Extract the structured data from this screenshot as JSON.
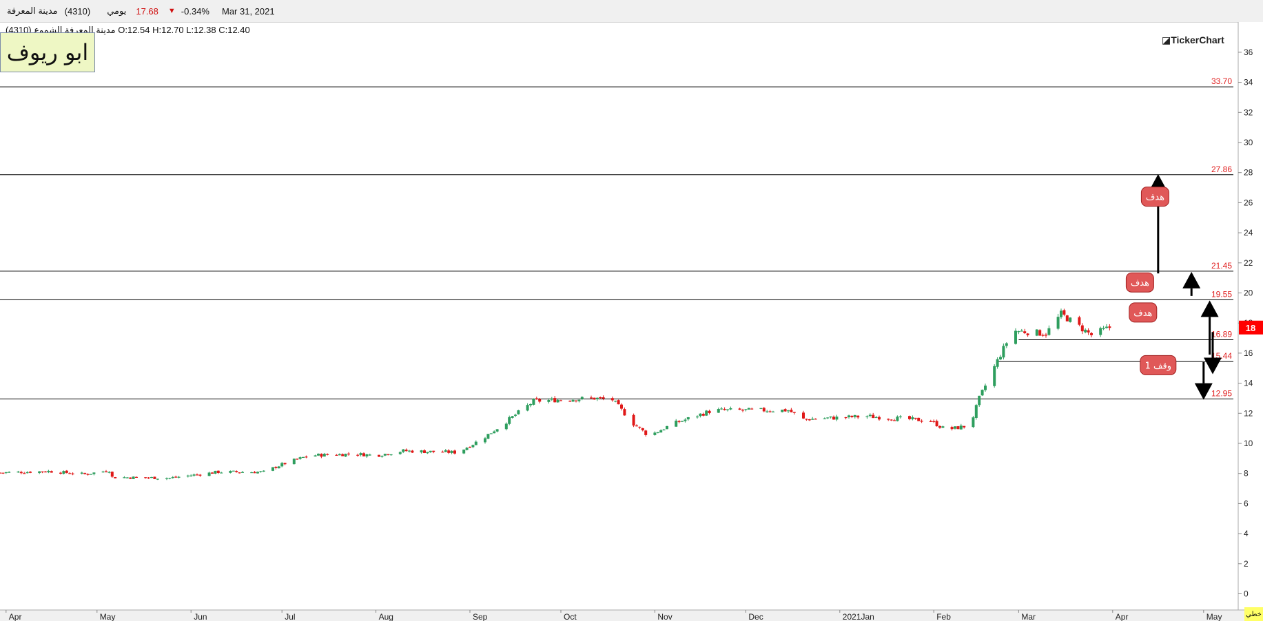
{
  "header": {
    "name": "مدينة المعرفة",
    "code": "(4310)",
    "period": "يومي",
    "price": "17.68",
    "change": "-0.34%",
    "date": "Mar 31, 2021",
    "down_color": "#d01010"
  },
  "ohlc_line": "مدينة المعرفة الشموع (4310) O:12.54  H:12.70  L:12.38  C:12.40",
  "watermark_text": "ابو ريوف",
  "logo_text": "◪TickerChart",
  "corner_label": "خطي",
  "chart_data": {
    "type": "candlestick",
    "y_range": [
      0,
      37
    ],
    "y_ticks": [
      0,
      2,
      4,
      6,
      8,
      10,
      12,
      14,
      16,
      18,
      20,
      22,
      24,
      26,
      28,
      30,
      32,
      34,
      36
    ],
    "x_domain": [
      "2020-03-30",
      "2021-05-04"
    ],
    "x_labels": [
      {
        "date": "2020-04-01",
        "label": "Apr"
      },
      {
        "date": "2020-05-01",
        "label": "May"
      },
      {
        "date": "2020-06-01",
        "label": "Jun"
      },
      {
        "date": "2020-07-01",
        "label": "Jul"
      },
      {
        "date": "2020-08-01",
        "label": "Aug"
      },
      {
        "date": "2020-09-01",
        "label": "Sep"
      },
      {
        "date": "2020-10-01",
        "label": "Oct"
      },
      {
        "date": "2020-11-01",
        "label": "Nov"
      },
      {
        "date": "2020-12-01",
        "label": "Dec"
      },
      {
        "date": "2021-01-01",
        "label": "2021Jan"
      },
      {
        "date": "2021-02-01",
        "label": "Feb"
      },
      {
        "date": "2021-03-01",
        "label": "Mar"
      },
      {
        "date": "2021-04-01",
        "label": "Apr"
      },
      {
        "date": "2021-05-01",
        "label": "May"
      }
    ],
    "last_price_label": "18",
    "up_color": "#2e9e5e",
    "down_color": "#e01818",
    "horizontal_levels": [
      {
        "value": 33.7,
        "label": "33.70"
      },
      {
        "value": 27.86,
        "label": "27.86"
      },
      {
        "value": 21.45,
        "label": "21.45"
      },
      {
        "value": 19.55,
        "label": "19.55"
      },
      {
        "value": 12.95,
        "label": "12.95"
      }
    ],
    "short_levels": [
      {
        "value": 16.89,
        "label": "16.89",
        "from": "2021-03-01"
      },
      {
        "value": 15.44,
        "label": "15.44",
        "from": "2021-02-22"
      }
    ],
    "annotations": [
      {
        "text": "هدف",
        "date": "2021-04-15",
        "value": 26.4
      },
      {
        "text": "هدف",
        "date": "2021-04-10",
        "value": 20.7
      },
      {
        "text": "هدف",
        "date": "2021-04-11",
        "value": 18.7
      },
      {
        "text": "وقف 1",
        "date": "2021-04-16",
        "value": 15.2
      }
    ],
    "arrows": [
      {
        "date": "2021-04-16",
        "from": 21.3,
        "to": 27.9
      },
      {
        "date": "2021-04-27",
        "from": 19.8,
        "to": 21.4
      },
      {
        "date": "2021-05-03",
        "from": 15.9,
        "to": 19.5
      },
      {
        "date": "2021-05-04",
        "from": 17.4,
        "to": 14.6
      },
      {
        "date": "2021-05-01",
        "from": 15.4,
        "to": 12.9
      }
    ],
    "anchors": [
      [
        "2020-03-30",
        8.05
      ],
      [
        "2020-04-15",
        8.15
      ],
      [
        "2020-04-27",
        7.95
      ],
      [
        "2020-05-05",
        8.2
      ],
      [
        "2020-05-06",
        7.75
      ],
      [
        "2020-05-25",
        7.7
      ],
      [
        "2020-06-10",
        8.1
      ],
      [
        "2020-06-25",
        8.1
      ],
      [
        "2020-07-01",
        8.6
      ],
      [
        "2020-07-10",
        9.2
      ],
      [
        "2020-07-25",
        9.3
      ],
      [
        "2020-08-01",
        9.2
      ],
      [
        "2020-08-10",
        9.5
      ],
      [
        "2020-08-28",
        9.4
      ],
      [
        "2020-09-05",
        10.3
      ],
      [
        "2020-09-12",
        11.3
      ],
      [
        "2020-09-22",
        12.8
      ],
      [
        "2020-09-30",
        12.9
      ],
      [
        "2020-10-12",
        13.0
      ],
      [
        "2020-10-18",
        12.9
      ],
      [
        "2020-10-25",
        11.3
      ],
      [
        "2020-10-30",
        10.5
      ],
      [
        "2020-11-07",
        11.3
      ],
      [
        "2020-11-20",
        12.2
      ],
      [
        "2020-12-15",
        12.2
      ],
      [
        "2020-12-20",
        11.6
      ],
      [
        "2021-01-10",
        11.8
      ],
      [
        "2021-01-31",
        11.5
      ],
      [
        "2021-02-05",
        10.9
      ],
      [
        "2021-02-13",
        11.2
      ],
      [
        "2021-02-16",
        13.0
      ],
      [
        "2021-02-22",
        15.5
      ],
      [
        "2021-02-27",
        17.5
      ],
      [
        "2021-03-10",
        17.3
      ],
      [
        "2021-03-15",
        18.6
      ],
      [
        "2021-03-25",
        17.2
      ],
      [
        "2021-03-31",
        17.7
      ]
    ],
    "first_candle": "2020-03-30",
    "last_candle": "2021-03-31"
  }
}
